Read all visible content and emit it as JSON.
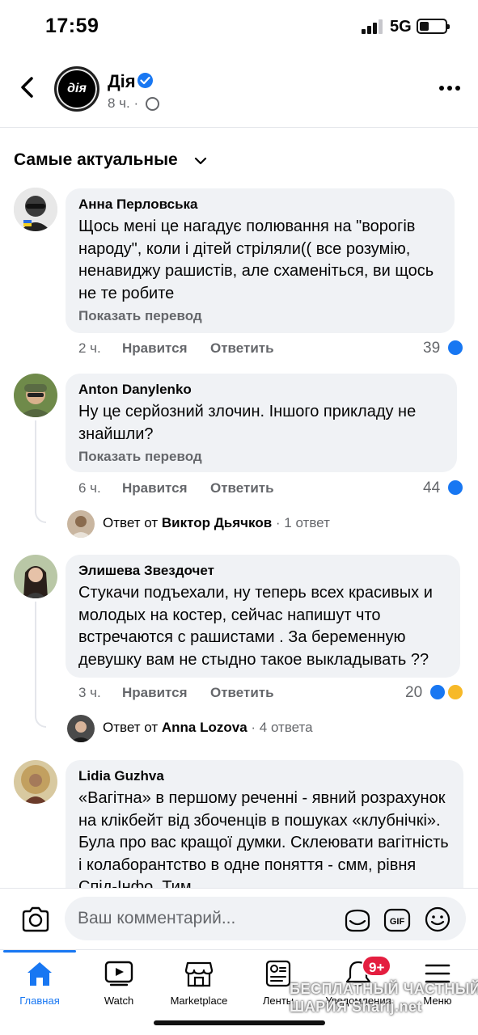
{
  "status_bar": {
    "time": "17:59",
    "network": "5G"
  },
  "header": {
    "page_name": "Дія",
    "logo_text": "дія",
    "post_time": "8 ч. ·"
  },
  "sort": {
    "label": "Самые актуальные"
  },
  "comments": [
    {
      "author": "Анна Перловська",
      "text": "Щось мені це нагадує полювання на \"ворогів народу\", коли і дітей стріляли(( все розумію, ненавиджу рашистів, але схаменіться, ви щось не те робите",
      "translate": "Показать перевод",
      "time": "2 ч.",
      "like": "Нравится",
      "reply": "Ответить",
      "reactions": "39"
    },
    {
      "author": "Anton Danylenko",
      "text": "Ну це серйозний злочин. Іншого прикладу не знайшли?",
      "translate": "Показать перевод",
      "time": "6 ч.",
      "like": "Нравится",
      "reply": "Ответить",
      "reactions": "44",
      "replies": {
        "prefix": "Ответ от",
        "name": "Виктор Дьячков",
        "count": "· 1 ответ"
      }
    },
    {
      "author": "Элишева Звездочет",
      "text": "Стукачи подъехали, ну теперь всех красивых и молодых на костер, сейчас напишут что встречаются с рашистами . За беременную девушку вам не стыдно такое выкладывать ??",
      "time": "3 ч.",
      "like": "Нравится",
      "reply": "Ответить",
      "reactions": "20",
      "replies": {
        "prefix": "Ответ от",
        "name": "Anna Lozova",
        "count": "· 4 ответа"
      }
    },
    {
      "author": "Lidia Guzhva",
      "text": "«Вагітна» в першому реченні - явний розрахунок на клікбейт від збоченців в пошуках «клубнічкі». Була про вас кращої думки. Склеювати вагітність і колаборантство в одне поняття - смм, рівня Спід-Інфо. Тим"
    }
  ],
  "composer": {
    "placeholder": "Ваш комментарий..."
  },
  "tabs": [
    {
      "label": "Главная",
      "icon": "home-icon"
    },
    {
      "label": "Watch",
      "icon": "watch-icon"
    },
    {
      "label": "Marketplace",
      "icon": "marketplace-icon"
    },
    {
      "label": "Ленты",
      "icon": "feeds-icon"
    },
    {
      "label": "Уведомления",
      "icon": "bell-icon"
    },
    {
      "label": "Меню",
      "icon": "menu-icon"
    }
  ],
  "notifications_badge": "9+",
  "watermark": {
    "line1": "БЕСПЛАТНЫЙ ЧАСТНЫЙ",
    "line2": "ШАРИЯ  Sharij.net"
  },
  "colors": {
    "accent": "#1877f2",
    "bubble": "#f0f2f5",
    "muted": "#65676b",
    "badge": "#e41e3f"
  }
}
